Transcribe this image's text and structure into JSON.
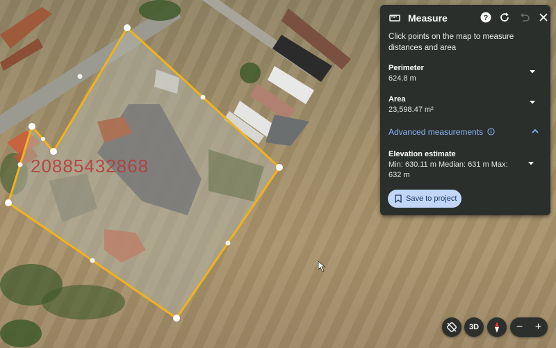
{
  "panel": {
    "title": "Measure",
    "instructions": "Click points on the map to measure distances and area",
    "perimeter_label": "Perimeter",
    "perimeter_value": "624.8 m",
    "area_label": "Area",
    "area_value": "23,598.47 m²",
    "advanced_label": "Advanced measurements",
    "elevation_label": "Elevation estimate",
    "elevation_value": "Min: 630.11 m   Median: 631 m   Max: 632 m",
    "save_label": "Save to project",
    "icons": {
      "ruler": "ruler-icon",
      "help": "help-icon",
      "refresh": "refresh-icon",
      "undo": "undo-icon",
      "close": "close-icon",
      "info": "info-icon",
      "bookmark": "bookmark-icon"
    },
    "accent_color": "#8ab4f8"
  },
  "map": {
    "watermark": "20885432868",
    "polygon_color": "#f2b21b"
  },
  "controls": {
    "tilt_icon": "tilt-icon",
    "view_3d_label": "3D",
    "compass_icon": "compass-icon",
    "zoom_out_label": "−",
    "zoom_in_label": "+"
  }
}
